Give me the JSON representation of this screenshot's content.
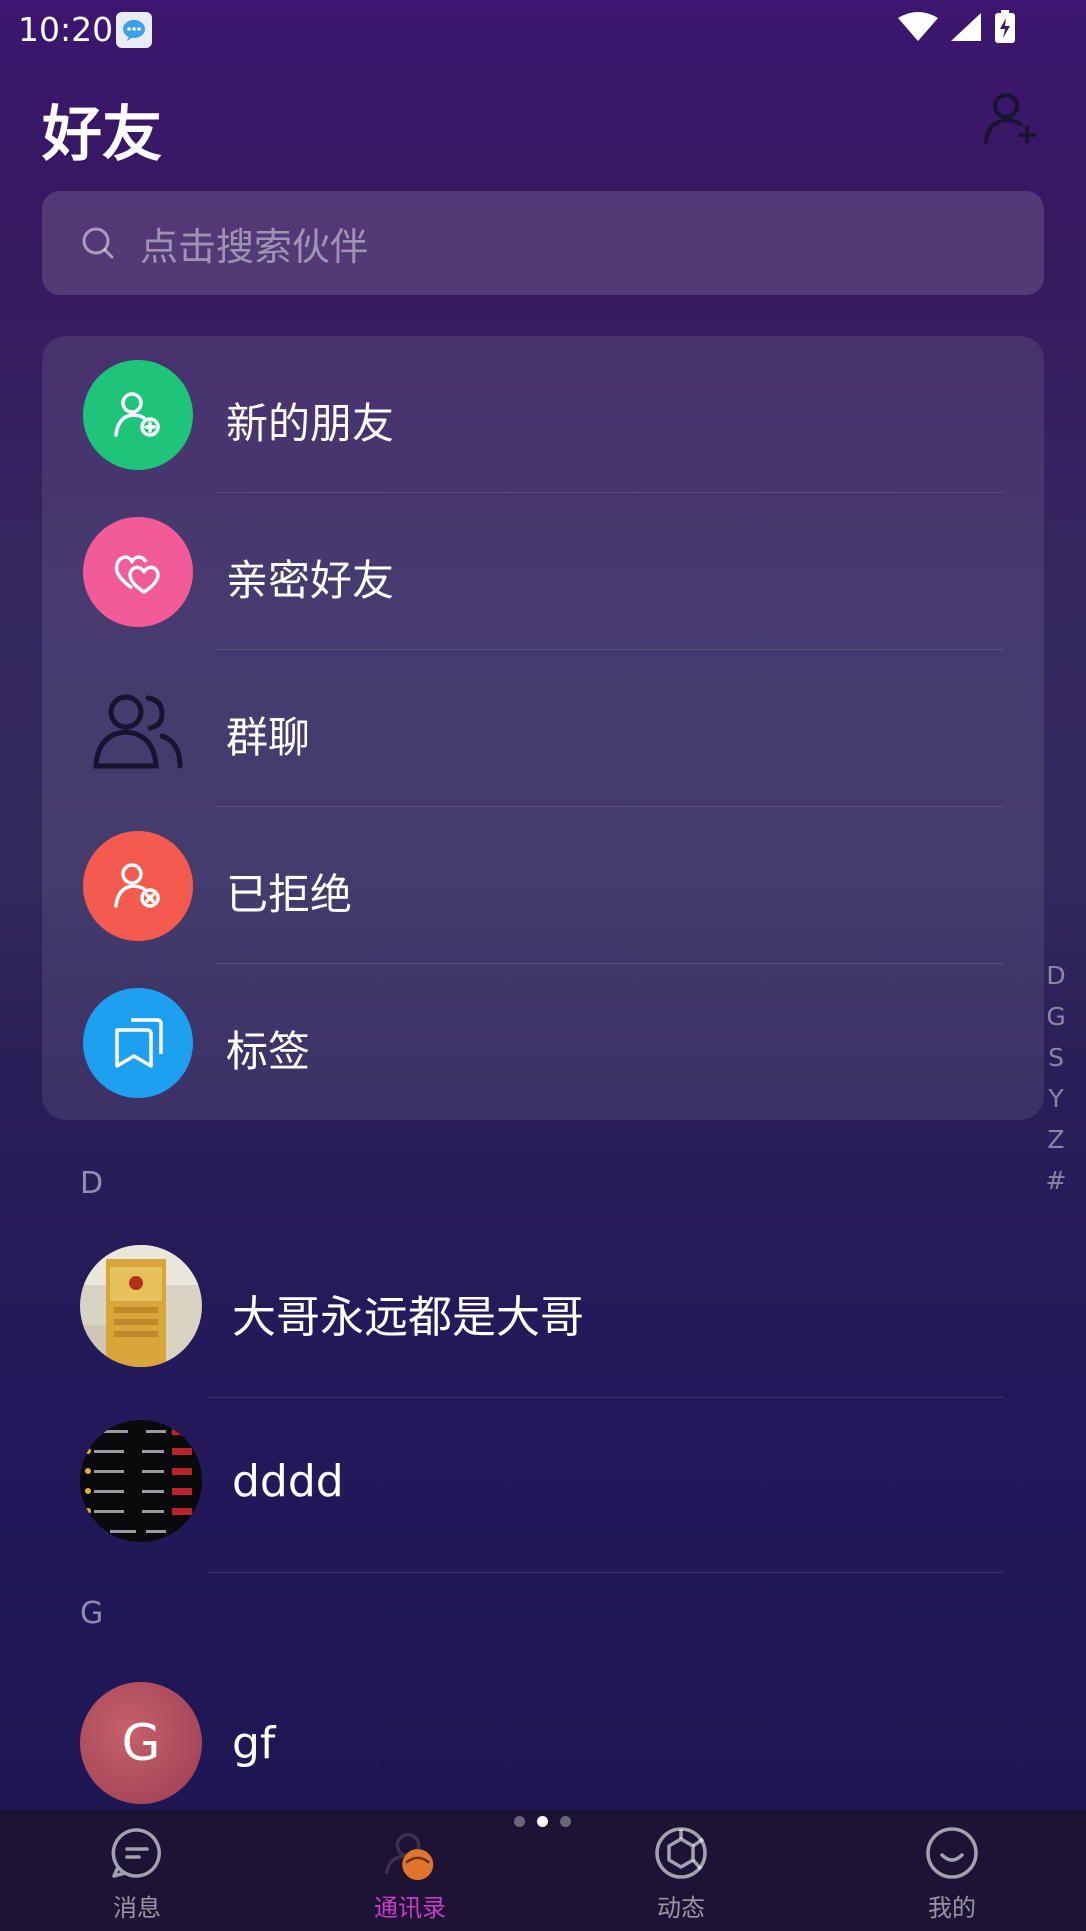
{
  "status_bar": {
    "time": "10:20"
  },
  "header": {
    "title": "好友"
  },
  "search": {
    "placeholder": "点击搜索伙伴"
  },
  "menu": [
    {
      "label": "新的朋友",
      "icon": "person-add-icon",
      "color": "#1ec47a"
    },
    {
      "label": "亲密好友",
      "icon": "hearts-icon",
      "color": "#f25b98"
    },
    {
      "label": "群聊",
      "icon": "group-icon",
      "color": "transparent"
    },
    {
      "label": "已拒绝",
      "icon": "person-remove-icon",
      "color": "#f55a4e"
    },
    {
      "label": "标签",
      "icon": "tags-icon",
      "color": "#1ea0f0"
    }
  ],
  "index_letters": [
    "D",
    "G",
    "S",
    "Y",
    "Z",
    "#"
  ],
  "sections": [
    {
      "letter": "D",
      "contacts": [
        {
          "name": "大哥永远都是大哥"
        },
        {
          "name": "dddd"
        }
      ]
    },
    {
      "letter": "G",
      "contacts": [
        {
          "name": "gf",
          "avatar_letter": "G"
        }
      ]
    }
  ],
  "tabs": [
    {
      "label": "消息",
      "icon": "message-icon"
    },
    {
      "label": "通讯录",
      "icon": "contacts-icon",
      "active": true
    },
    {
      "label": "动态",
      "icon": "moments-icon"
    },
    {
      "label": "我的",
      "icon": "profile-icon"
    }
  ]
}
